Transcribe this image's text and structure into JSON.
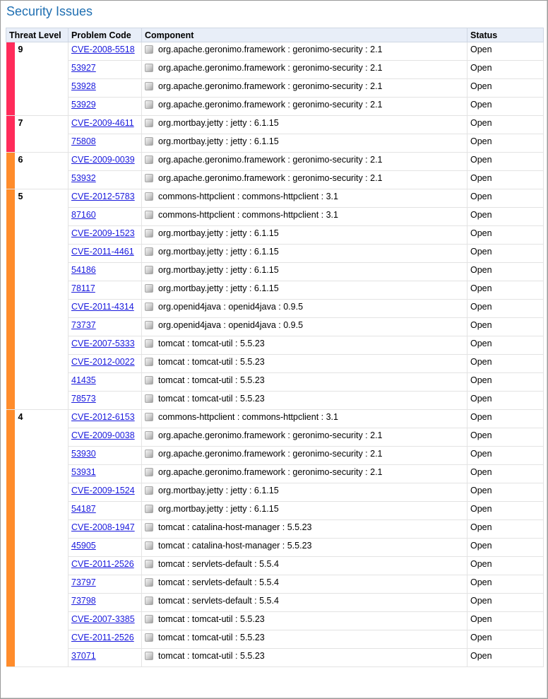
{
  "page": {
    "title": "Security Issues"
  },
  "colors": {
    "critical": "#ff2b5a",
    "high": "#ff8c2b"
  },
  "table": {
    "headers": {
      "threat_level": "Threat Level",
      "problem_code": "Problem Code",
      "component": "Component",
      "status": "Status"
    },
    "groups": [
      {
        "level": "9",
        "color": "critical",
        "rows": [
          {
            "code": "CVE-2008-5518",
            "component": "org.apache.geronimo.framework : geronimo-security : 2.1",
            "status": "Open"
          },
          {
            "code": "53927",
            "component": "org.apache.geronimo.framework : geronimo-security : 2.1",
            "status": "Open"
          },
          {
            "code": "53928",
            "component": "org.apache.geronimo.framework : geronimo-security : 2.1",
            "status": "Open"
          },
          {
            "code": "53929",
            "component": "org.apache.geronimo.framework : geronimo-security : 2.1",
            "status": "Open"
          }
        ]
      },
      {
        "level": "7",
        "color": "critical",
        "rows": [
          {
            "code": "CVE-2009-4611",
            "component": "org.mortbay.jetty : jetty : 6.1.15",
            "status": "Open"
          },
          {
            "code": "75808",
            "component": "org.mortbay.jetty : jetty : 6.1.15",
            "status": "Open"
          }
        ]
      },
      {
        "level": "6",
        "color": "high",
        "rows": [
          {
            "code": "CVE-2009-0039",
            "component": "org.apache.geronimo.framework : geronimo-security : 2.1",
            "status": "Open"
          },
          {
            "code": "53932",
            "component": "org.apache.geronimo.framework : geronimo-security : 2.1",
            "status": "Open"
          }
        ]
      },
      {
        "level": "5",
        "color": "high",
        "rows": [
          {
            "code": "CVE-2012-5783",
            "component": "commons-httpclient : commons-httpclient : 3.1",
            "status": "Open"
          },
          {
            "code": "87160",
            "component": "commons-httpclient : commons-httpclient : 3.1",
            "status": "Open"
          },
          {
            "code": "CVE-2009-1523",
            "component": "org.mortbay.jetty : jetty : 6.1.15",
            "status": "Open"
          },
          {
            "code": "CVE-2011-4461",
            "component": "org.mortbay.jetty : jetty : 6.1.15",
            "status": "Open"
          },
          {
            "code": "54186",
            "component": "org.mortbay.jetty : jetty : 6.1.15",
            "status": "Open"
          },
          {
            "code": "78117",
            "component": "org.mortbay.jetty : jetty : 6.1.15",
            "status": "Open"
          },
          {
            "code": "CVE-2011-4314",
            "component": "org.openid4java : openid4java : 0.9.5",
            "status": "Open"
          },
          {
            "code": "73737",
            "component": "org.openid4java : openid4java : 0.9.5",
            "status": "Open"
          },
          {
            "code": "CVE-2007-5333",
            "component": "tomcat : tomcat-util : 5.5.23",
            "status": "Open"
          },
          {
            "code": "CVE-2012-0022",
            "component": "tomcat : tomcat-util : 5.5.23",
            "status": "Open"
          },
          {
            "code": "41435",
            "component": "tomcat : tomcat-util : 5.5.23",
            "status": "Open"
          },
          {
            "code": "78573",
            "component": "tomcat : tomcat-util : 5.5.23",
            "status": "Open"
          }
        ]
      },
      {
        "level": "4",
        "color": "high",
        "rows": [
          {
            "code": "CVE-2012-6153",
            "component": "commons-httpclient : commons-httpclient : 3.1",
            "status": "Open"
          },
          {
            "code": "CVE-2009-0038",
            "component": "org.apache.geronimo.framework : geronimo-security : 2.1",
            "status": "Open"
          },
          {
            "code": "53930",
            "component": "org.apache.geronimo.framework : geronimo-security : 2.1",
            "status": "Open"
          },
          {
            "code": "53931",
            "component": "org.apache.geronimo.framework : geronimo-security : 2.1",
            "status": "Open"
          },
          {
            "code": "CVE-2009-1524",
            "component": "org.mortbay.jetty : jetty : 6.1.15",
            "status": "Open"
          },
          {
            "code": "54187",
            "component": "org.mortbay.jetty : jetty : 6.1.15",
            "status": "Open"
          },
          {
            "code": "CVE-2008-1947",
            "component": "tomcat : catalina-host-manager : 5.5.23",
            "status": "Open"
          },
          {
            "code": "45905",
            "component": "tomcat : catalina-host-manager : 5.5.23",
            "status": "Open"
          },
          {
            "code": "CVE-2011-2526",
            "component": "tomcat : servlets-default : 5.5.4",
            "status": "Open"
          },
          {
            "code": "73797",
            "component": "tomcat : servlets-default : 5.5.4",
            "status": "Open"
          },
          {
            "code": "73798",
            "component": "tomcat : servlets-default : 5.5.4",
            "status": "Open"
          },
          {
            "code": "CVE-2007-3385",
            "component": "tomcat : tomcat-util : 5.5.23",
            "status": "Open"
          },
          {
            "code": "CVE-2011-2526",
            "component": "tomcat : tomcat-util : 5.5.23",
            "status": "Open"
          },
          {
            "code": "37071",
            "component": "tomcat : tomcat-util : 5.5.23",
            "status": "Open"
          }
        ]
      }
    ],
    "component_icon": "package-icon"
  }
}
